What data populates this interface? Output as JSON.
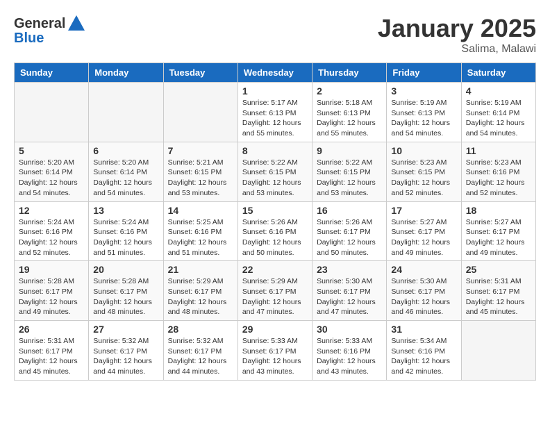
{
  "logo": {
    "text_general": "General",
    "text_blue": "Blue"
  },
  "header": {
    "month": "January 2025",
    "location": "Salima, Malawi"
  },
  "days_of_week": [
    "Sunday",
    "Monday",
    "Tuesday",
    "Wednesday",
    "Thursday",
    "Friday",
    "Saturday"
  ],
  "weeks": [
    [
      {
        "day": "",
        "info": ""
      },
      {
        "day": "",
        "info": ""
      },
      {
        "day": "",
        "info": ""
      },
      {
        "day": "1",
        "info": "Sunrise: 5:17 AM\nSunset: 6:13 PM\nDaylight: 12 hours\nand 55 minutes."
      },
      {
        "day": "2",
        "info": "Sunrise: 5:18 AM\nSunset: 6:13 PM\nDaylight: 12 hours\nand 55 minutes."
      },
      {
        "day": "3",
        "info": "Sunrise: 5:19 AM\nSunset: 6:13 PM\nDaylight: 12 hours\nand 54 minutes."
      },
      {
        "day": "4",
        "info": "Sunrise: 5:19 AM\nSunset: 6:14 PM\nDaylight: 12 hours\nand 54 minutes."
      }
    ],
    [
      {
        "day": "5",
        "info": "Sunrise: 5:20 AM\nSunset: 6:14 PM\nDaylight: 12 hours\nand 54 minutes."
      },
      {
        "day": "6",
        "info": "Sunrise: 5:20 AM\nSunset: 6:14 PM\nDaylight: 12 hours\nand 54 minutes."
      },
      {
        "day": "7",
        "info": "Sunrise: 5:21 AM\nSunset: 6:15 PM\nDaylight: 12 hours\nand 53 minutes."
      },
      {
        "day": "8",
        "info": "Sunrise: 5:22 AM\nSunset: 6:15 PM\nDaylight: 12 hours\nand 53 minutes."
      },
      {
        "day": "9",
        "info": "Sunrise: 5:22 AM\nSunset: 6:15 PM\nDaylight: 12 hours\nand 53 minutes."
      },
      {
        "day": "10",
        "info": "Sunrise: 5:23 AM\nSunset: 6:15 PM\nDaylight: 12 hours\nand 52 minutes."
      },
      {
        "day": "11",
        "info": "Sunrise: 5:23 AM\nSunset: 6:16 PM\nDaylight: 12 hours\nand 52 minutes."
      }
    ],
    [
      {
        "day": "12",
        "info": "Sunrise: 5:24 AM\nSunset: 6:16 PM\nDaylight: 12 hours\nand 52 minutes."
      },
      {
        "day": "13",
        "info": "Sunrise: 5:24 AM\nSunset: 6:16 PM\nDaylight: 12 hours\nand 51 minutes."
      },
      {
        "day": "14",
        "info": "Sunrise: 5:25 AM\nSunset: 6:16 PM\nDaylight: 12 hours\nand 51 minutes."
      },
      {
        "day": "15",
        "info": "Sunrise: 5:26 AM\nSunset: 6:16 PM\nDaylight: 12 hours\nand 50 minutes."
      },
      {
        "day": "16",
        "info": "Sunrise: 5:26 AM\nSunset: 6:17 PM\nDaylight: 12 hours\nand 50 minutes."
      },
      {
        "day": "17",
        "info": "Sunrise: 5:27 AM\nSunset: 6:17 PM\nDaylight: 12 hours\nand 49 minutes."
      },
      {
        "day": "18",
        "info": "Sunrise: 5:27 AM\nSunset: 6:17 PM\nDaylight: 12 hours\nand 49 minutes."
      }
    ],
    [
      {
        "day": "19",
        "info": "Sunrise: 5:28 AM\nSunset: 6:17 PM\nDaylight: 12 hours\nand 49 minutes."
      },
      {
        "day": "20",
        "info": "Sunrise: 5:28 AM\nSunset: 6:17 PM\nDaylight: 12 hours\nand 48 minutes."
      },
      {
        "day": "21",
        "info": "Sunrise: 5:29 AM\nSunset: 6:17 PM\nDaylight: 12 hours\nand 48 minutes."
      },
      {
        "day": "22",
        "info": "Sunrise: 5:29 AM\nSunset: 6:17 PM\nDaylight: 12 hours\nand 47 minutes."
      },
      {
        "day": "23",
        "info": "Sunrise: 5:30 AM\nSunset: 6:17 PM\nDaylight: 12 hours\nand 47 minutes."
      },
      {
        "day": "24",
        "info": "Sunrise: 5:30 AM\nSunset: 6:17 PM\nDaylight: 12 hours\nand 46 minutes."
      },
      {
        "day": "25",
        "info": "Sunrise: 5:31 AM\nSunset: 6:17 PM\nDaylight: 12 hours\nand 45 minutes."
      }
    ],
    [
      {
        "day": "26",
        "info": "Sunrise: 5:31 AM\nSunset: 6:17 PM\nDaylight: 12 hours\nand 45 minutes."
      },
      {
        "day": "27",
        "info": "Sunrise: 5:32 AM\nSunset: 6:17 PM\nDaylight: 12 hours\nand 44 minutes."
      },
      {
        "day": "28",
        "info": "Sunrise: 5:32 AM\nSunset: 6:17 PM\nDaylight: 12 hours\nand 44 minutes."
      },
      {
        "day": "29",
        "info": "Sunrise: 5:33 AM\nSunset: 6:17 PM\nDaylight: 12 hours\nand 43 minutes."
      },
      {
        "day": "30",
        "info": "Sunrise: 5:33 AM\nSunset: 6:16 PM\nDaylight: 12 hours\nand 43 minutes."
      },
      {
        "day": "31",
        "info": "Sunrise: 5:34 AM\nSunset: 6:16 PM\nDaylight: 12 hours\nand 42 minutes."
      },
      {
        "day": "",
        "info": ""
      }
    ]
  ]
}
